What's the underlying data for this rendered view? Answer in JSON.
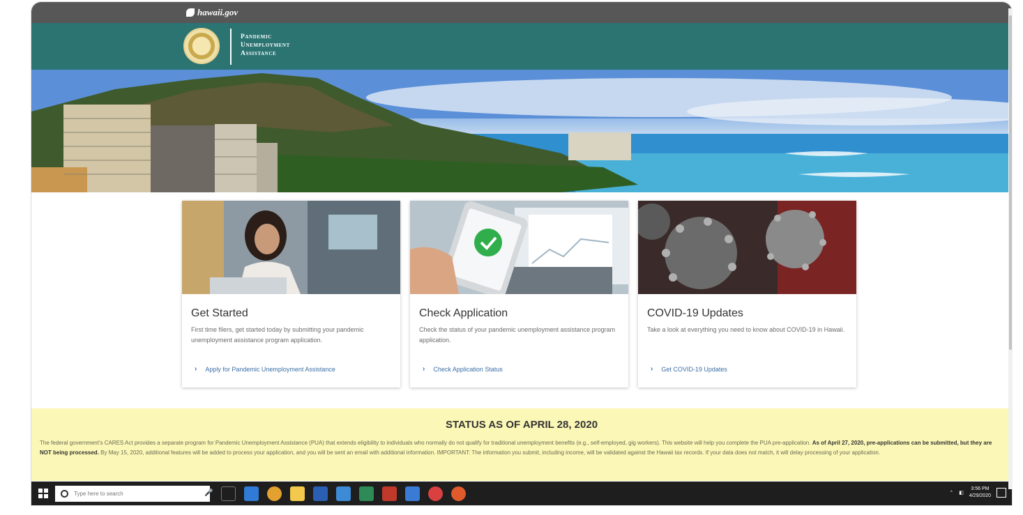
{
  "site": {
    "portal_label": "hawaii.gov"
  },
  "header": {
    "agency_line1": "Pandemic",
    "agency_line2": "Unemployment",
    "agency_line3": "Assistance"
  },
  "cards": [
    {
      "title": "Get Started",
      "description": "First time filers, get started today by submitting your pandemic unemployment assistance program application.",
      "link": "Apply for Pandemic Unemployment Assistance",
      "image": "woman-at-laptop-photo"
    },
    {
      "title": "Check Application",
      "description": "Check the status of your pandemic unemployment assistance program application.",
      "link": "Check Application Status",
      "image": "phone-checkmark-photo"
    },
    {
      "title": "COVID-19 Updates",
      "description": "Take a look at everything you need to know about COVID-19 in Hawaii.",
      "link": "Get COVID-19 Updates",
      "image": "virus-photo"
    }
  ],
  "status": {
    "heading": "STATUS AS OF APRIL 28, 2020",
    "text_part1": "The federal government's CARES Act provides a separate program for Pandemic Unemployment Assistance (PUA) that extends eligibility to individuals who normally do not qualify for traditional unemployment benefits (e.g., self-employed, gig workers). This website will help you complete the PUA pre-application.",
    "text_bold": "As of April 27, 2020, pre-applications can be submitted, but they are NOT being processed.",
    "text_part2": "By May 15, 2020, additional features will be added to process your application, and you will be sent an email with additional information. IMPORTANT: The information you submit, including income, will be validated against the Hawaii tax records. If your data does not match, it will delay processing of your application."
  },
  "taskbar": {
    "search_placeholder": "Type here to search",
    "time": "3:56 PM",
    "date": "4/29/2020"
  },
  "colors": {
    "header_teal": "#2b7472",
    "topbar_gray": "#575757",
    "status_bg": "#fbf7b6",
    "link_blue": "#3a6ea5"
  }
}
